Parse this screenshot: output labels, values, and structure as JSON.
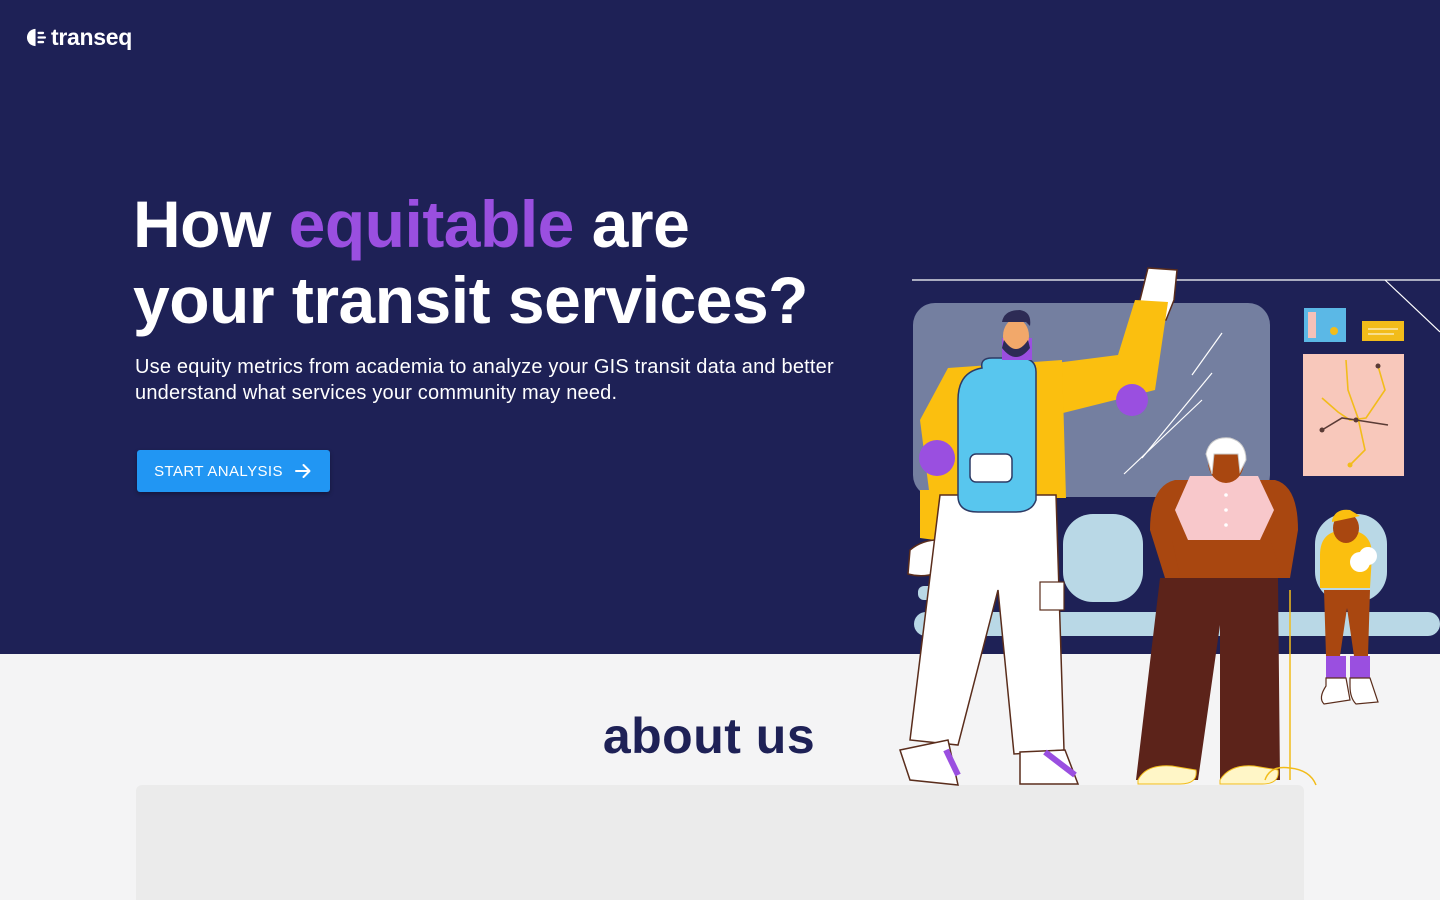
{
  "brand": {
    "name": "transeq",
    "logo_icon": "transeq-logo-icon"
  },
  "hero": {
    "headline_line1_before": "How ",
    "headline_accent": "equitable",
    "headline_line1_after": " are",
    "headline_line2": "your transit services?",
    "subtitle": "Use equity metrics from academia to analyze your GIS transit data and better understand what services your community may need.",
    "cta_label": "START ANALYSIS",
    "cta_icon": "arrow-right-icon"
  },
  "about": {
    "title": "about us"
  },
  "colors": {
    "hero_bg": "#1e2156",
    "accent": "#9a4fe0",
    "button": "#2196f3",
    "page_bg": "#f4f4f5",
    "about_title": "#1e2156"
  }
}
